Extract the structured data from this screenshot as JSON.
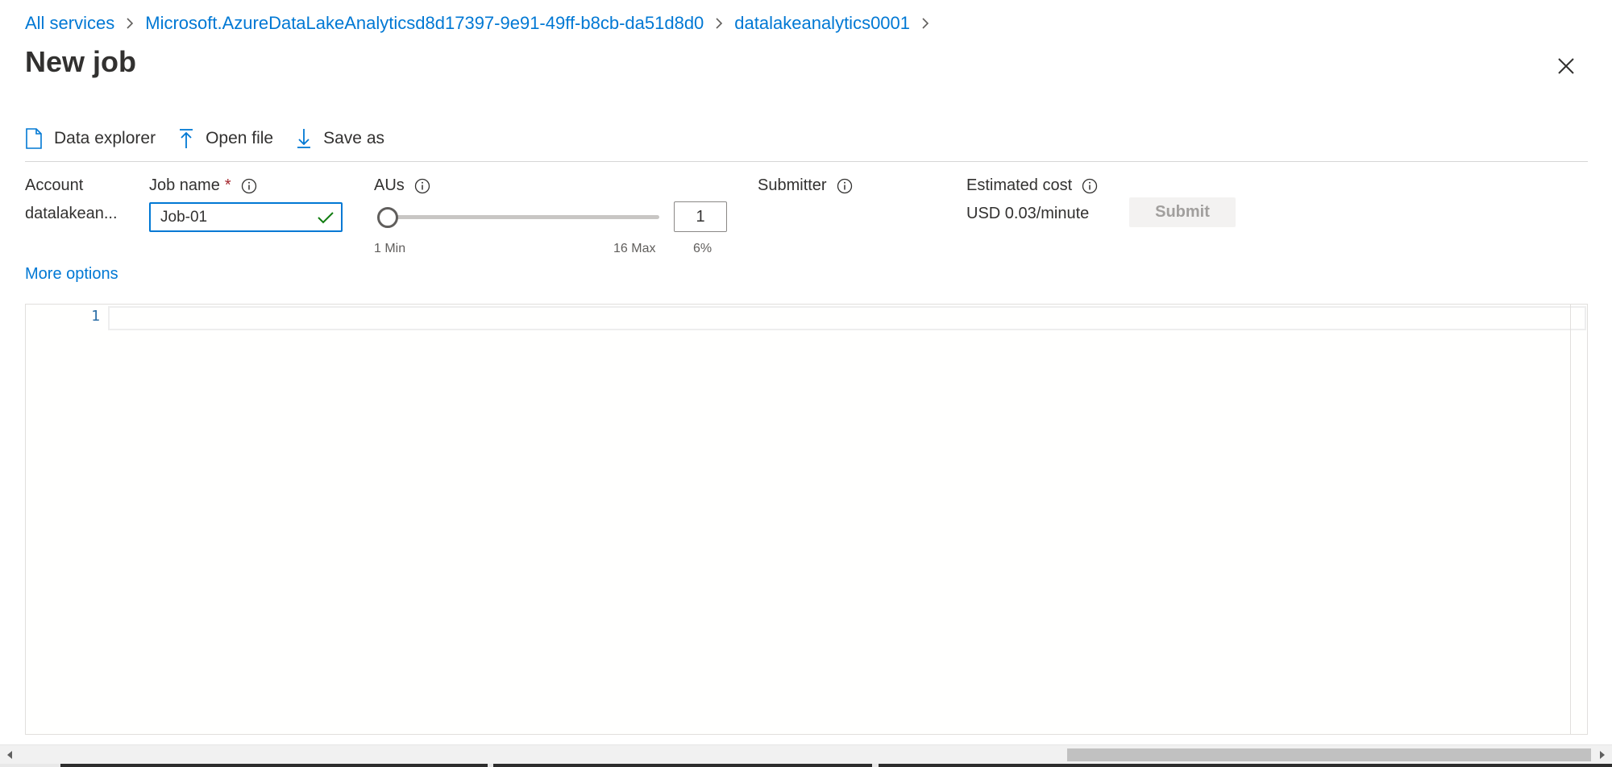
{
  "breadcrumb": {
    "items": [
      {
        "label": "All services"
      },
      {
        "label": "Microsoft.AzureDataLakeAnalyticsd8d17397-9e91-49ff-b8cb-da51d8d0"
      },
      {
        "label": "datalakeanalytics0001"
      }
    ]
  },
  "page": {
    "title": "New job"
  },
  "icons": {
    "close": "close-icon",
    "data_explorer": "document-icon",
    "open_file": "upload-icon",
    "save_as": "download-icon",
    "info": "info-icon",
    "check": "checkmark-icon"
  },
  "toolbar": {
    "data_explorer_label": "Data explorer",
    "open_file_label": "Open file",
    "save_as_label": "Save as"
  },
  "form": {
    "account": {
      "label": "Account",
      "value": "datalakean..."
    },
    "job_name": {
      "label": "Job name",
      "required_marker": "*",
      "value": "Job-01"
    },
    "aus": {
      "label": "AUs",
      "value": "1",
      "min_caption": "1 Min",
      "max_caption": "16 Max",
      "percent_caption": "6%",
      "slider_fraction": 0
    },
    "submitter": {
      "label": "Submitter"
    },
    "estimated_cost": {
      "label": "Estimated cost",
      "value": "USD 0.03/minute"
    },
    "submit_label": "Submit",
    "more_options_label": "More options"
  },
  "editor": {
    "line_numbers": [
      "1"
    ],
    "content": ""
  },
  "colors": {
    "accent": "#0078d4",
    "required": "#a4262c",
    "valid": "#107c10",
    "disabled_bg": "#f3f2f1",
    "disabled_text": "#a19f9d"
  }
}
